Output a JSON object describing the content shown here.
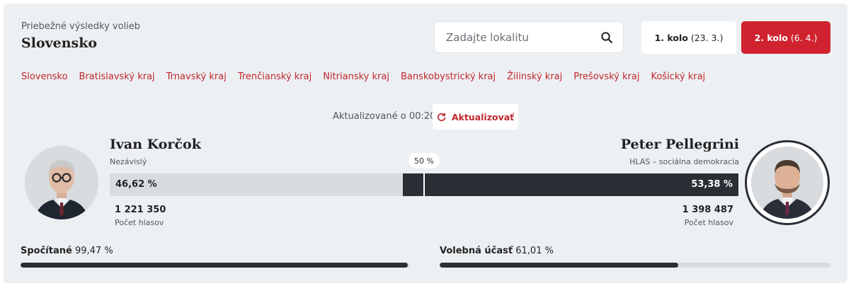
{
  "header": {
    "subtitle": "Priebežné výsledky volieb",
    "title": "Slovensko"
  },
  "search": {
    "placeholder": "Zadajte lokalitu",
    "icon": "search-icon"
  },
  "rounds": [
    {
      "label": "1. kolo",
      "date": "(23. 3.)",
      "active": false
    },
    {
      "label": "2. kolo",
      "date": "(6. 4.)",
      "active": true
    }
  ],
  "regions": [
    "Slovensko",
    "Bratislavský kraj",
    "Trnavský kraj",
    "Trenčianský kraj",
    "Nitriansky kraj",
    "Banskobystrický kraj",
    "Žilinský kraj",
    "Prešovský kraj",
    "Košický kraj"
  ],
  "update": {
    "text": "Aktualizované o 00:20",
    "button": "Aktualizovať",
    "icon": "refresh-icon"
  },
  "candidates": {
    "left": {
      "name": "Ivan Korčok",
      "party": "Nezávislý",
      "percent_label": "46,62 %",
      "share": 46.62,
      "votes": "1 221 350",
      "votes_label": "Počet hlasov"
    },
    "right": {
      "name": "Peter Pellegrini",
      "party": "HLAS – sociálna demokracia",
      "percent_label": "53,38 %",
      "share": 53.38,
      "votes": "1 398 487",
      "votes_label": "Počet hlasov"
    },
    "midpoint_label": "50 %"
  },
  "stats": {
    "counted": {
      "label": "Spočítané",
      "value": "99,47 %",
      "fraction": 0.9947
    },
    "turnout": {
      "label": "Volebná účasť",
      "value": "61,01 %",
      "fraction": 0.6101
    }
  },
  "colors": {
    "accent": "#d0232f",
    "link": "#c0272d",
    "dark_bar": "#2a2f36",
    "light_bar": "#d9dcdf",
    "panel_bg": "#edf0f3"
  }
}
